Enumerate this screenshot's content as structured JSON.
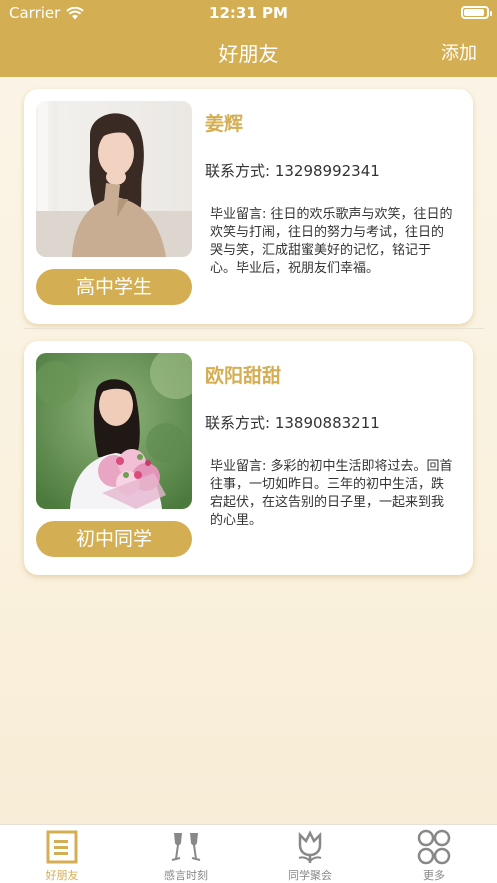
{
  "status_bar": {
    "carrier": "Carrier",
    "time": "12:31 PM",
    "battery_level": 1.0
  },
  "nav": {
    "title": "好朋友",
    "add_label": "添加"
  },
  "friends": [
    {
      "name": "姜辉",
      "contact": "联系方式: 13298992341",
      "message": "毕业留言: 往日的欢乐歌声与欢笑，往日的欢笑与打闹，往日的努力与考试，往日的哭与笑，汇成甜蜜美好的记忆，铭记于心。毕业后，祝朋友们幸福。",
      "tag": "高中学生"
    },
    {
      "name": "欧阳甜甜",
      "contact": "联系方式: 13890883211",
      "message": "毕业留言: 多彩的初中生活即将过去。回首往事，一切如昨日。三年的初中生活，跌宕起伏，在这告别的日子里，一起来到我的心里。",
      "tag": "初中同学"
    }
  ],
  "tabs": [
    {
      "label": "好朋友",
      "icon": "document-icon",
      "active": true
    },
    {
      "label": "感言时刻",
      "icon": "champagne-glasses-icon",
      "active": false
    },
    {
      "label": "同学聚会",
      "icon": "tulip-icon",
      "active": false
    },
    {
      "label": "更多",
      "icon": "four-circles-icon",
      "active": false
    }
  ],
  "colors": {
    "accent": "#d4ae52",
    "background": "#fbf5e8",
    "inactive": "#888888"
  }
}
